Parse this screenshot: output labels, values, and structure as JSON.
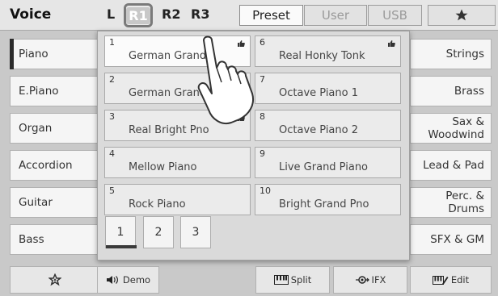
{
  "header": {
    "title": "Voice",
    "parts": [
      "L",
      "R1",
      "R2",
      "R3"
    ],
    "selected_part": "R1",
    "tabs": [
      "Preset",
      "User",
      "USB"
    ],
    "active_tab": "Preset",
    "favorites_icon": "star-icon"
  },
  "categories_left": [
    "Piano",
    "E.Piano",
    "Organ",
    "Accordion",
    "Guitar",
    "Bass"
  ],
  "categories_right": [
    "Strings",
    "Brass",
    "Sax &\nWoodwind",
    "Lead & Pad",
    "Perc. &\nDrums",
    "SFX & GM"
  ],
  "selected_category": "Piano",
  "voices": [
    {
      "num": "1",
      "name": "German Grand",
      "favorite": true
    },
    {
      "num": "2",
      "name": "German Grand 2",
      "favorite": false
    },
    {
      "num": "3",
      "name": "Real Bright Pno",
      "favorite": true
    },
    {
      "num": "4",
      "name": "Mellow Piano",
      "favorite": false
    },
    {
      "num": "5",
      "name": "Rock Piano",
      "favorite": false
    },
    {
      "num": "6",
      "name": "Real Honky Tonk",
      "favorite": true
    },
    {
      "num": "7",
      "name": "Octave Piano 1",
      "favorite": false
    },
    {
      "num": "8",
      "name": "Octave Piano 2",
      "favorite": false
    },
    {
      "num": "9",
      "name": "Live Grand Piano",
      "favorite": false
    },
    {
      "num": "10",
      "name": "Bright Grand Pno",
      "favorite": false
    }
  ],
  "selected_voice": "1",
  "pages": [
    "1",
    "2",
    "3"
  ],
  "active_page": "1",
  "bottom_bar": {
    "favorite_icon": "star-outline-icon",
    "demo_label": "Demo",
    "split_label": "Split",
    "fx_label": "IFX",
    "edit_label": "Edit"
  }
}
